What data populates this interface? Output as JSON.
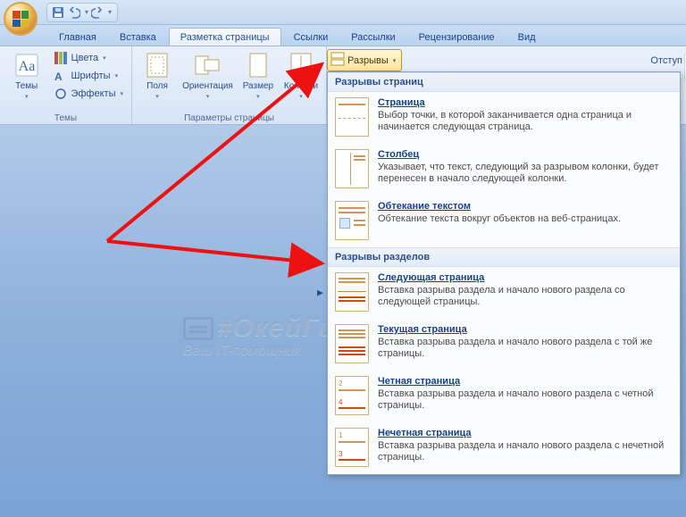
{
  "qat": {
    "save": "save",
    "undo": "undo",
    "redo": "redo"
  },
  "tabs": {
    "home": "Главная",
    "insert": "Вставка",
    "pagelayout": "Разметка страницы",
    "references": "Ссылки",
    "mailings": "Рассылки",
    "review": "Рецензирование",
    "view": "Вид"
  },
  "themes": {
    "big": "Темы",
    "colors": "Цвета",
    "fonts": "Шрифты",
    "effects": "Эффекты",
    "group": "Темы"
  },
  "pagesetup": {
    "margins": "Поля",
    "orientation": "Ориентация",
    "size": "Размер",
    "columns": "Колонки",
    "group": "Параметры страницы"
  },
  "breaks_btn": "Разрывы",
  "right_label": "Отступ",
  "gallery": {
    "section1": "Разрывы страниц",
    "page": {
      "title": "Страница",
      "desc": "Выбор точки, в которой заканчивается одна страница и начинается следующая страница."
    },
    "column": {
      "title": "Столбец",
      "desc": "Указывает, что текст, следующий за разрывом колонки, будет перенесен в начало следующей колонки."
    },
    "textwrap": {
      "title": "Обтекание текстом",
      "desc": "Обтекание текста вокруг объектов на веб-страницах."
    },
    "section2": "Разрывы разделов",
    "nextpage": {
      "title": "Следующая страница",
      "desc": "Вставка разрыва раздела и начало нового раздела со следующей страницы."
    },
    "continuous": {
      "title": "Текущая страница",
      "desc": "Вставка разрыва раздела и начало нового раздела с той же страницы."
    },
    "evenpage": {
      "title": "Четная страница",
      "desc": "Вставка разрыва раздела и начало нового раздела с четной страницы."
    },
    "oddpage": {
      "title": "Нечетная страница",
      "desc": "Вставка разрыва раздела и начало нового раздела с нечетной страницы."
    }
  },
  "watermark": {
    "main": "#ОкейГик",
    "sub": "Ваш IT-помощник"
  }
}
